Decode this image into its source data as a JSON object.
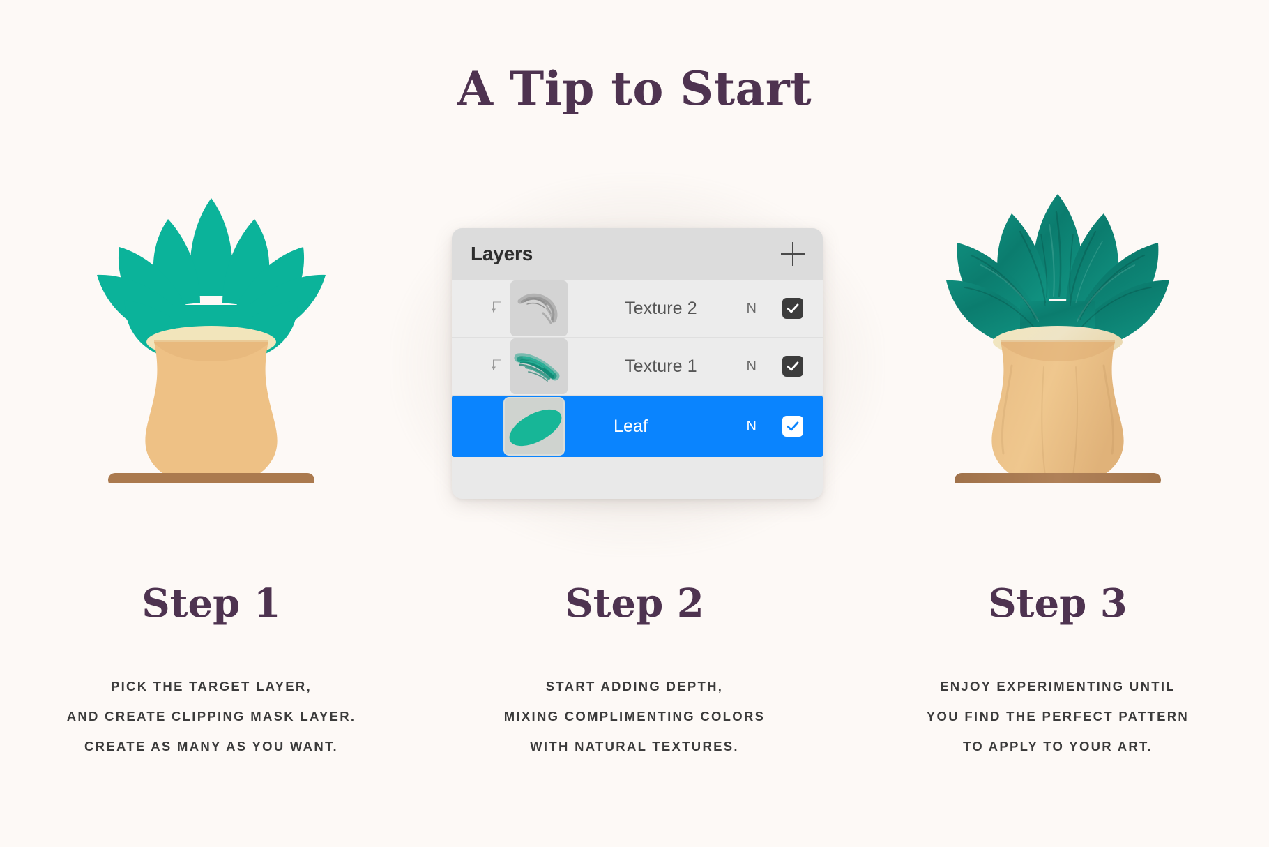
{
  "title": "A Tip to Start",
  "background_color": "#fdf9f6",
  "heading_color": "#4e3350",
  "accent_color": "#0a84fe",
  "leaf_color": "#0bb39a",
  "leaf_color_textured": "#0d8274",
  "pot_color": "#eec185",
  "pot_rim_color": "#f2e5bb",
  "saucer_color": "#ab7a4e",
  "panel": {
    "title": "Layers",
    "add_icon": "plus-icon",
    "rows": [
      {
        "name": "Texture 2",
        "blend_mode": "N",
        "visible": true,
        "clipping_mask": true,
        "thumbnail": "gray-brush-stroke-thumbnail",
        "selected": false
      },
      {
        "name": "Texture 1",
        "blend_mode": "N",
        "visible": true,
        "clipping_mask": true,
        "thumbnail": "teal-brush-stroke-thumbnail",
        "selected": false
      },
      {
        "name": "Leaf",
        "blend_mode": "N",
        "visible": true,
        "clipping_mask": false,
        "thumbnail": "teal-leaf-shape-thumbnail",
        "selected": true
      }
    ]
  },
  "steps": [
    {
      "heading": "Step 1",
      "art": "flat-teal-potted-plant",
      "lines": [
        "Pick the target layer,",
        "and create clipping mask layer.",
        "Create as many as you want."
      ]
    },
    {
      "heading": "Step 2",
      "art": "layers-panel",
      "lines": [
        "Start adding depth,",
        "mixing complimenting colors",
        "with natural textures."
      ]
    },
    {
      "heading": "Step 3",
      "art": "textured-teal-potted-plant",
      "lines": [
        "Enjoy experimenting until",
        "you find the perfect pattern",
        "to apply to your art."
      ]
    }
  ]
}
